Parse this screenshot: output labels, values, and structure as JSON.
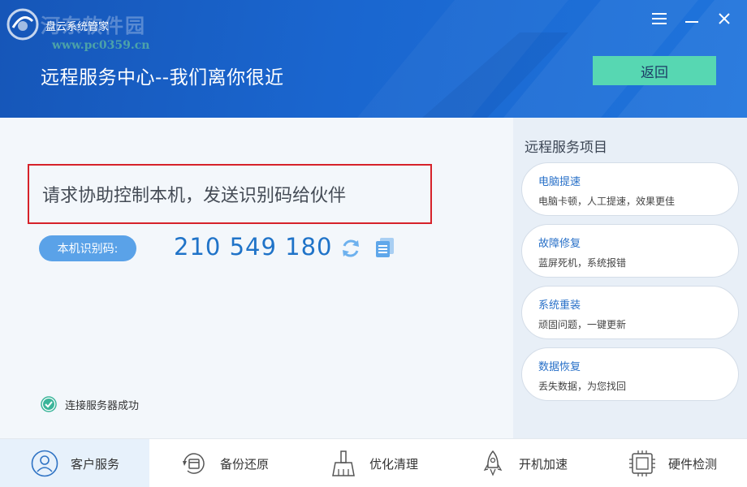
{
  "header": {
    "app_name": "盘云系统管家",
    "watermark_text": "河东软件园",
    "watermark_url": "www.pc0359.cn",
    "title": "远程服务中心--我们离你很近",
    "back_label": "返回"
  },
  "main": {
    "request_text": "请求协助控制本机，发送识别码给伙伴",
    "id_label": "本机识别码:",
    "id_code": "210 549 180",
    "status_text": "连接服务器成功"
  },
  "sidebar": {
    "title": "远程服务项目",
    "items": [
      {
        "title": "电脑提速",
        "desc": "电脑卡顿，人工提速，效果更佳"
      },
      {
        "title": "故障修复",
        "desc": "蓝屏死机，系统报错"
      },
      {
        "title": "系统重装",
        "desc": "顽固问题，一键更新"
      },
      {
        "title": "数据恢复",
        "desc": "丢失数据，为您找回"
      }
    ]
  },
  "nav": [
    {
      "label": "客户服务",
      "icon": "user-icon",
      "active": true
    },
    {
      "label": "备份还原",
      "icon": "backup-icon"
    },
    {
      "label": "优化清理",
      "icon": "brush-icon"
    },
    {
      "label": "开机加速",
      "icon": "rocket-icon"
    },
    {
      "label": "硬件检测",
      "icon": "chip-icon"
    }
  ],
  "colors": {
    "header_blue": "#1a66cf",
    "accent_green": "#57d7b2",
    "code_blue": "#1f73c8",
    "highlight_red": "#d6222a"
  }
}
